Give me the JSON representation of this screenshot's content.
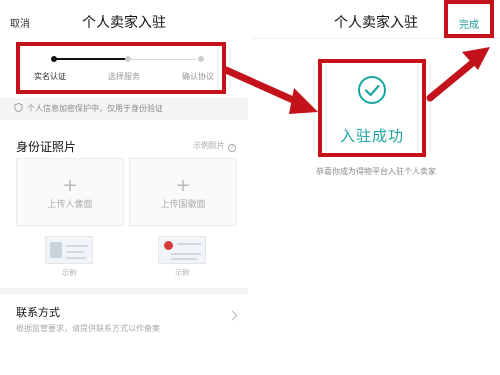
{
  "left": {
    "nav": {
      "cancel": "取消",
      "title": "个人卖家入驻"
    },
    "steps": [
      {
        "label": "实名认证",
        "active": true
      },
      {
        "label": "选择服务",
        "active": false
      },
      {
        "label": "确认协议",
        "active": false
      }
    ],
    "privacy_note": "个人信息加密保护中，仅用于身份验证",
    "id_section": {
      "title": "身份证照片",
      "sample_link": "示例照片",
      "upload_front": "上传人像面",
      "upload_back": "上传国徽面",
      "sample_caption": "示例"
    },
    "contact": {
      "title": "联系方式",
      "description": "根据监管要求，请提供联系方式以作备案"
    }
  },
  "right": {
    "title": "个人卖家入驻",
    "done_button": "完成",
    "success_text": "入驻成功",
    "congrats": "恭喜你成为得物平台入驻个人卖家"
  },
  "colors": {
    "highlight": "#c4121b",
    "accent": "#1aa6a0"
  },
  "icons": [
    "shield-icon",
    "question-icon",
    "plus-icon",
    "chevron-right-icon",
    "check-circle-icon",
    "arrow-icon"
  ]
}
